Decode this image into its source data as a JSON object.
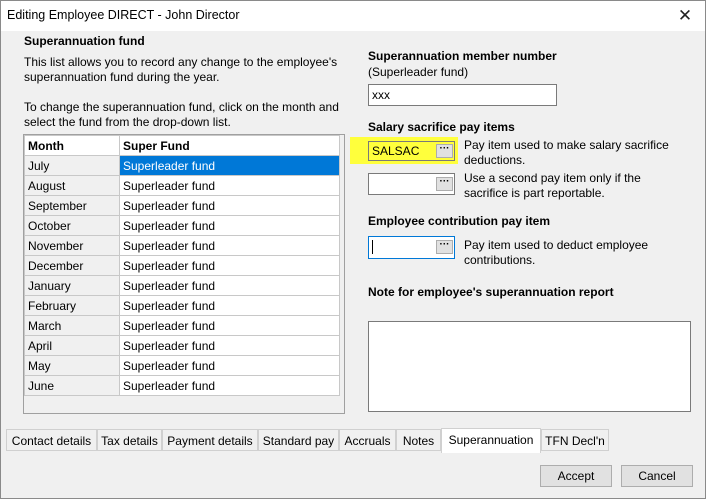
{
  "window": {
    "title": "Editing Employee DIRECT - John Director",
    "close_glyph": "✕"
  },
  "left": {
    "heading": "Superannuation fund",
    "intro_line1": "This list allows you to record any change to the employee's",
    "intro_line2": "superannuation fund during the year.",
    "instr_line1": "To change the superannuation fund, click on the month and",
    "instr_line2": "select the fund from the drop-down list.",
    "grid": {
      "col_month": "Month",
      "col_fund": "Super Fund",
      "rows": [
        {
          "month": "July",
          "fund": "Superleader fund"
        },
        {
          "month": "August",
          "fund": "Superleader fund"
        },
        {
          "month": "September",
          "fund": "Superleader fund"
        },
        {
          "month": "October",
          "fund": "Superleader fund"
        },
        {
          "month": "November",
          "fund": "Superleader fund"
        },
        {
          "month": "December",
          "fund": "Superleader fund"
        },
        {
          "month": "January",
          "fund": "Superleader fund"
        },
        {
          "month": "February",
          "fund": "Superleader fund"
        },
        {
          "month": "March",
          "fund": "Superleader fund"
        },
        {
          "month": "April",
          "fund": "Superleader fund"
        },
        {
          "month": "May",
          "fund": "Superleader fund"
        },
        {
          "month": "June",
          "fund": "Superleader fund"
        }
      ]
    }
  },
  "right": {
    "member_heading": "Superannuation member number",
    "member_sub": "(Superleader fund)",
    "member_value": "xxx",
    "salsac_heading": "Salary sacrifice pay items",
    "salsac_value": "SALSAC",
    "salsac_desc1": "Pay item used to make salary sacrifice",
    "salsac_desc2": "deductions.",
    "second_value": "",
    "second_desc1": "Use a second pay item only if the",
    "second_desc2": "sacrifice is part reportable.",
    "contrib_heading": "Employee contribution pay item",
    "contrib_value": "",
    "contrib_desc1": "Pay item used to deduct employee",
    "contrib_desc2": "contributions.",
    "note_heading": "Note for employee's superannuation report",
    "note_value": "",
    "ellipsis": "···",
    "highlight_color": "#ffff3c"
  },
  "tabs": [
    "Contact details",
    "Tax details",
    "Payment details",
    "Standard pay",
    "Accruals",
    "Notes",
    "Superannuation",
    "TFN Decl'n"
  ],
  "active_tab": "Superannuation",
  "buttons": {
    "accept": "Accept",
    "cancel": "Cancel"
  }
}
